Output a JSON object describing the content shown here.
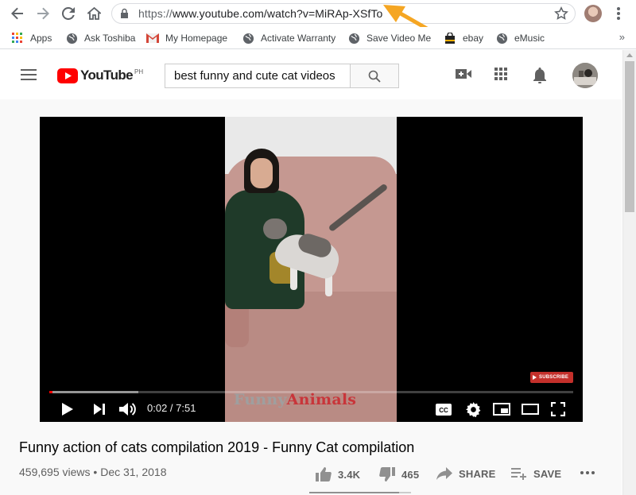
{
  "browser": {
    "url_proto": "https://",
    "url_rest": "www.youtube.com/watch?v=MiRAp-XSfTo",
    "annotation_arrow_color": "#f5a623"
  },
  "bookmarks": [
    {
      "label": "Apps",
      "icon": "apps-grid-icon"
    },
    {
      "label": "Ask Toshiba",
      "icon": "globe-icon"
    },
    {
      "label": "My Homepage",
      "icon": "gmail-icon"
    },
    {
      "label": "Activate Warranty",
      "icon": "globe-icon"
    },
    {
      "label": "Save Video Me",
      "icon": "globe-icon"
    },
    {
      "label": "ebay",
      "icon": "shopping-bag-icon"
    },
    {
      "label": "eMusic",
      "icon": "globe-icon"
    }
  ],
  "bookmarks_more": "»",
  "youtube": {
    "logo_text": "YouTube",
    "region": "PH",
    "search_query": "best funny and cute cat videos",
    "brand_color": "#ff0000"
  },
  "player": {
    "time_current": "0:02",
    "time_separator": " / ",
    "time_total": "7:51",
    "played_fraction": 0.004,
    "buffered_fraction": 0.17,
    "subscribe_label": "SUBSCRIBE",
    "watermark_part1": "Funny",
    "watermark_part2": "Animals"
  },
  "video": {
    "title": "Funny action of cats compilation 2019 - Funny Cat compilation",
    "views": "459,695 views",
    "dot": " • ",
    "date": "Dec 31, 2018",
    "likes": "3.4K",
    "dislikes": "465",
    "share_label": "SHARE",
    "save_label": "SAVE",
    "like_ratio": 0.88
  }
}
